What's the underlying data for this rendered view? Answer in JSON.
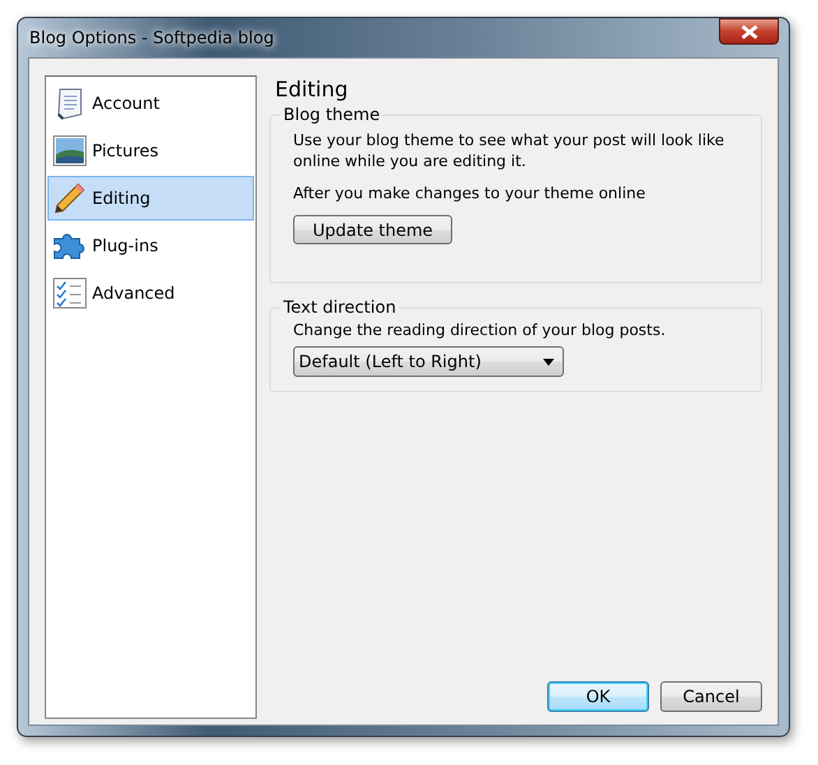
{
  "window": {
    "title": "Blog Options - Softpedia blog"
  },
  "sidebar": {
    "items": [
      {
        "label": "Account",
        "kind": "account",
        "selected": false
      },
      {
        "label": "Pictures",
        "kind": "pictures",
        "selected": false
      },
      {
        "label": "Editing",
        "kind": "editing",
        "selected": true
      },
      {
        "label": "Plug-ins",
        "kind": "plugins",
        "selected": false
      },
      {
        "label": "Advanced",
        "kind": "advanced",
        "selected": false
      }
    ]
  },
  "page": {
    "heading": "Editing",
    "blog_theme": {
      "title": "Blog theme",
      "description": "Use your blog theme to see what your post will look like online while you are editing it.",
      "note": "After you make changes to your theme online",
      "button": "Update theme"
    },
    "text_direction": {
      "title": "Text direction",
      "description": "Change the reading direction of your blog posts.",
      "dropdown": {
        "value": "Default (Left to Right)"
      }
    }
  },
  "buttons": [
    {
      "label": "OK",
      "default": true
    },
    {
      "label": "Cancel",
      "default": false
    }
  ]
}
